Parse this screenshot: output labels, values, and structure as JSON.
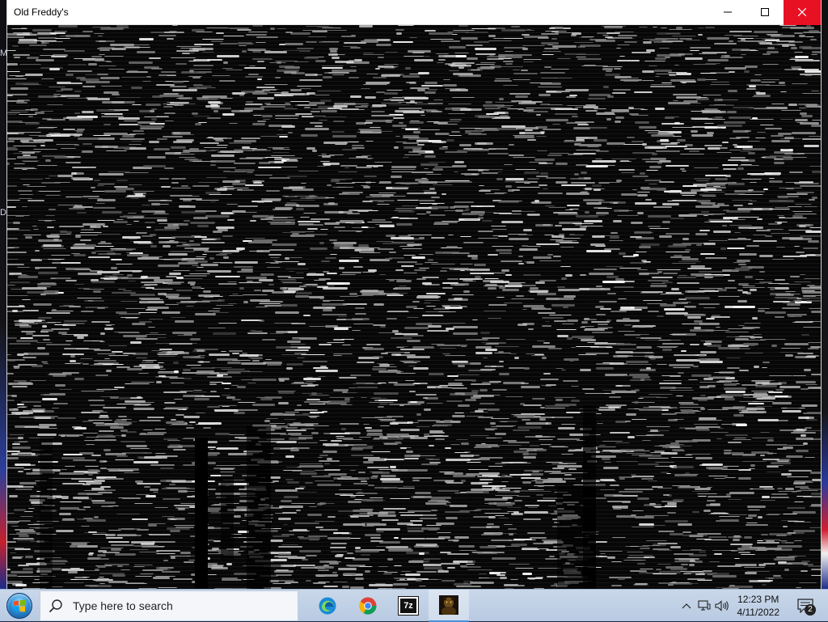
{
  "window": {
    "title": "Old Freddy's",
    "buttons": {
      "minimize_icon": "minimize-icon",
      "maximize_icon": "maximize-icon",
      "close_icon": "close-icon"
    },
    "content": "static-noise-screen"
  },
  "desktop": {
    "left_edge_glyphs": [
      "M",
      "D"
    ]
  },
  "taskbar": {
    "start_icon": "windows-start-icon",
    "search_placeholder": "Type here to search",
    "pinned": [
      {
        "name": "edge",
        "icon": "edge-icon"
      },
      {
        "name": "chrome",
        "icon": "chrome-icon"
      },
      {
        "name": "7zip",
        "icon": "seven-zip-icon",
        "label": "7z"
      },
      {
        "name": "old-freddys",
        "icon": "game-icon",
        "active": true
      }
    ],
    "tray": {
      "chevron_icon": "chevron-up-icon",
      "network_icon": "network-icon",
      "volume_icon": "volume-icon",
      "time": "12:23 PM",
      "date": "4/11/2022",
      "notification_icon": "notification-icon",
      "notification_count": "2"
    }
  },
  "colors": {
    "close_button": "#e81123",
    "taskbar": "#c4d3e7",
    "static_background": "#070707"
  }
}
